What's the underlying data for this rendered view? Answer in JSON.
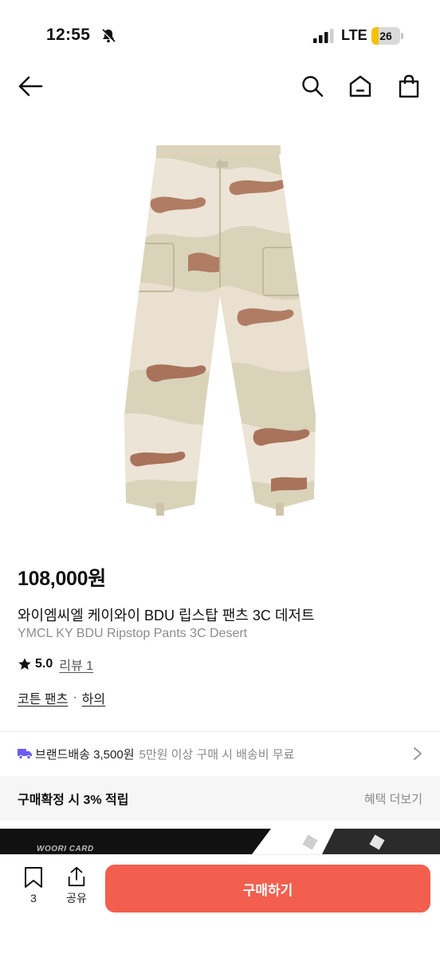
{
  "status_bar": {
    "time": "12:55",
    "network": "LTE",
    "battery_level": 26,
    "battery_text": "26",
    "icons": [
      "bell-muted-icon",
      "signal-icon",
      "battery-icon"
    ]
  },
  "header": {
    "icons": [
      "back-arrow-icon",
      "search-icon",
      "home-icon",
      "shopping-bag-icon"
    ]
  },
  "product": {
    "image": "camouflage-cargo-pants",
    "price": "108,000원",
    "title_ko": "와이엠씨엘 케이와이 BDU 립스탑 팬츠 3C 데저트",
    "title_en": "YMCL KY BDU Ripstop Pants 3C Desert",
    "rating": "5.0",
    "reviews": "리뷰 1",
    "category": "코튼 팬츠",
    "category_separator": "·",
    "subcategory": "하의"
  },
  "shipping": {
    "label": "브랜드배송 3,500원",
    "note": "5만원 이상 구매 시 배송비 무료"
  },
  "benefit": {
    "label": "구매확정 시 3% 적립",
    "more": "혜택 더보기"
  },
  "banner": {
    "text": "WOORI CARD"
  },
  "bottom_bar": {
    "like_count": "3",
    "share_label": "공유",
    "buy_label": "구매하기"
  },
  "colors": {
    "accent": "#f25f4f",
    "battery": "#f2c200",
    "shipping_icon": "#6b5cf6"
  }
}
